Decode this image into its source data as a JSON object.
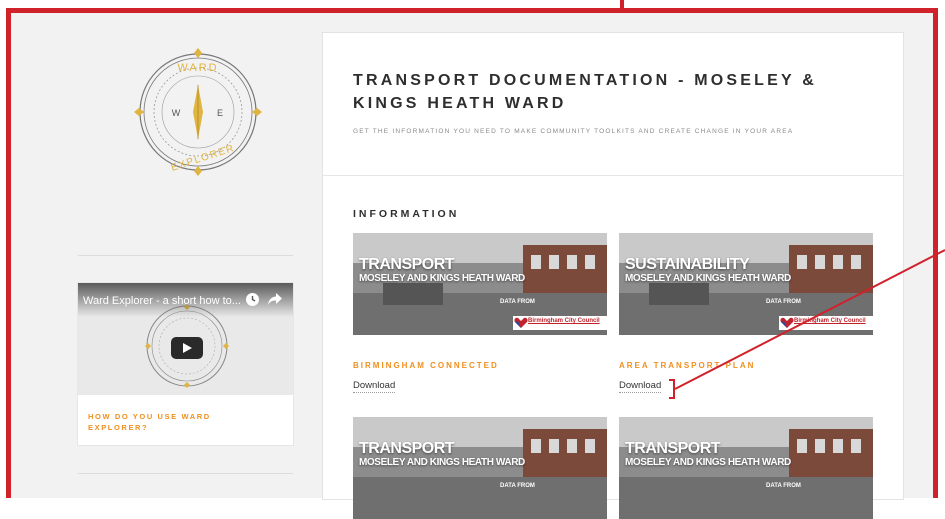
{
  "sidebar": {
    "logo": {
      "top_text": "WARD",
      "bottom_text": "EXPLORER",
      "west": "W",
      "east": "E"
    },
    "video": {
      "title": "Ward Explorer - a short how to...",
      "caption": "HOW DO YOU USE WARD EXPLORER?"
    }
  },
  "main": {
    "title": "TRANSPORT DOCUMENTATION - MOSELEY & KINGS HEATH WARD",
    "subtitle": "GET THE INFORMATION YOU NEED TO MAKE COMMUNITY TOOLKITS AND CREATE CHANGE IN YOUR AREA",
    "section_heading": "INFORMATION",
    "documents": [
      {
        "thumb_title": "TRANSPORT",
        "thumb_sub": "MOSELEY AND KINGS HEATH WARD",
        "data_from": "DATA FROM",
        "council": "Birmingham City Council",
        "title": "BIRMINGHAM CONNECTED",
        "link": "Download"
      },
      {
        "thumb_title": "SUSTAINABILITY",
        "thumb_sub": "MOSELEY AND KINGS HEATH WARD",
        "data_from": "DATA FROM",
        "council": "Birmingham City Council",
        "title": "AREA TRANSPORT PLAN",
        "link": "Download"
      },
      {
        "thumb_title": "TRANSPORT",
        "thumb_sub": "MOSELEY AND KINGS HEATH WARD",
        "data_from": "DATA FROM"
      },
      {
        "thumb_title": "TRANSPORT",
        "thumb_sub": "MOSELEY AND KINGS HEATH WARD",
        "data_from": "DATA FROM"
      }
    ]
  },
  "colors": {
    "annotation": "#d0222b",
    "accent": "#f09020",
    "gold": "#e0b440"
  }
}
